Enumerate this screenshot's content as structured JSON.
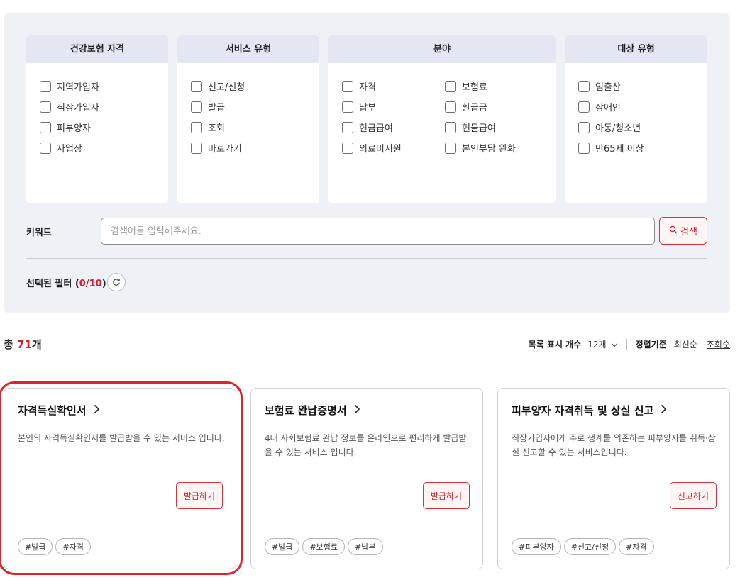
{
  "filters": {
    "groups": [
      {
        "title": "건강보험 자격",
        "items": [
          "지역가입자",
          "직장가입자",
          "피부양자",
          "사업장"
        ]
      },
      {
        "title": "서비스 유형",
        "items": [
          "신고/신청",
          "발급",
          "조회",
          "바로가기"
        ]
      },
      {
        "title": "분야",
        "items": [
          "자격",
          "납부",
          "현금급여",
          "의료비지원",
          "보험료",
          "환급금",
          "현물급여",
          "본인부담 완화"
        ]
      },
      {
        "title": "대상 유형",
        "items": [
          "임출산",
          "장애인",
          "아동/청소년",
          "만65세 이상"
        ]
      }
    ],
    "keyword_label": "키워드",
    "search_placeholder": "검색어를 입력해주세요.",
    "search_button": "검색",
    "selected_prefix": "선택된 필터 (",
    "selected_count": "0/10",
    "selected_suffix": ")"
  },
  "results": {
    "total_prefix": "총 ",
    "total_count": "71",
    "total_suffix": "개",
    "page_size_label": "목록 표시 개수",
    "page_size_value": "12개",
    "sort_label": "정렬기준",
    "sort_options": [
      "최신순",
      "조회순"
    ],
    "active_sort": "조회순"
  },
  "cards": [
    {
      "title": "자격득실확인서",
      "desc": "본인의 자격득실확인서를 발급받을 수 있는 서비스 입니다.",
      "button": "발급하기",
      "tags": [
        "#발급",
        "#자격"
      ]
    },
    {
      "title": "보험료 완납증명서",
      "desc": "4대 사회보험료 완납 정보를 온라인으로 편리하게 발급받을 수 있는 서비스 입니다.",
      "button": "발급하기",
      "tags": [
        "#발급",
        "#보험료",
        "#납부"
      ]
    },
    {
      "title": "피부양자 자격취득 및 상실 신고",
      "desc": "직장가입자에게 주로 생계를 의존하는 피부양자를 취득·상실 신고할 수 있는 서비스입니다.",
      "button": "신고하기",
      "tags": [
        "#피부양자",
        "#신고/신청",
        "#자격"
      ]
    }
  ],
  "colors": {
    "accent": "#d01f28",
    "panel_bg": "#eef1f6",
    "panel_head": "#e2e7f3"
  },
  "icons": {
    "search": "search-icon",
    "reset": "refresh-icon",
    "chevron_down": "chevron-down-icon",
    "chevron_right": "chevron-right-icon"
  }
}
